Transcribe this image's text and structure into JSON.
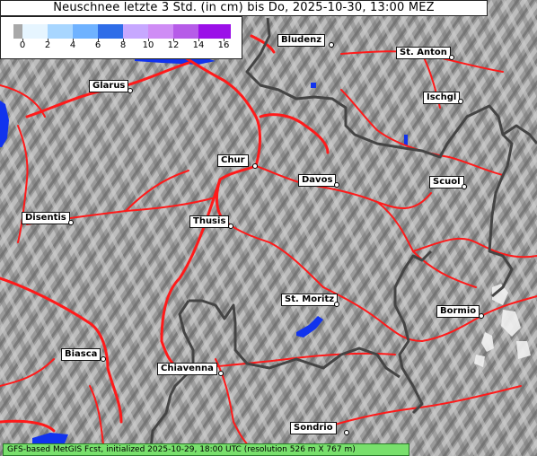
{
  "title": "Neuschnee letzte 3 Std. (in cm) bis Do, 2025-10-30, 13:00 MEZ",
  "legend": {
    "ticks": [
      "0",
      "2",
      "4",
      "6",
      "8",
      "10",
      "12",
      "14",
      "16"
    ],
    "colors": [
      "#e6f5ff",
      "#a8d6ff",
      "#6fb2ff",
      "#2f6de8",
      "#c7a8ff",
      "#cf8df5",
      "#b65ce8",
      "#9b10e8"
    ]
  },
  "places": [
    {
      "id": "bludenz",
      "name": "Bludenz"
    },
    {
      "id": "st-anton",
      "name": "St. Anton"
    },
    {
      "id": "glarus",
      "name": "Glarus"
    },
    {
      "id": "ischgl",
      "name": "Ischgl"
    },
    {
      "id": "chur",
      "name": "Chur"
    },
    {
      "id": "davos",
      "name": "Davos"
    },
    {
      "id": "scuol",
      "name": "Scuol"
    },
    {
      "id": "disentis",
      "name": "Disentis"
    },
    {
      "id": "thusis",
      "name": "Thusis"
    },
    {
      "id": "st-moritz",
      "name": "St. Moritz"
    },
    {
      "id": "bormio",
      "name": "Bormio"
    },
    {
      "id": "biasca",
      "name": "Biasca"
    },
    {
      "id": "chiavenna",
      "name": "Chiavenna"
    },
    {
      "id": "sondrio",
      "name": "Sondrio"
    }
  ],
  "footer": "GFS-based MetGIS Fcst, initialized 2025-10-29, 18:00 UTC  (resolution 526 m X 767 m)",
  "colors": {
    "road": "#ff1a1a",
    "border": "#444444",
    "water": "#1133ee",
    "footer_bg": "#78e06c"
  }
}
